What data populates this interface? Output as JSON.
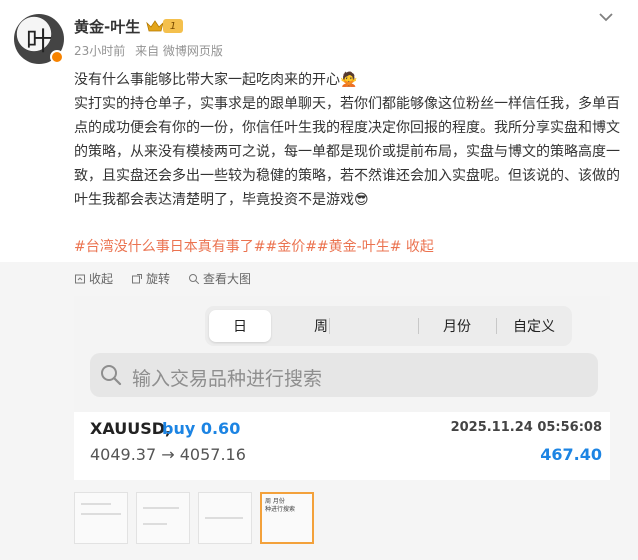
{
  "author": {
    "name": "黄金-叶生",
    "level": "1",
    "avatar_glyph": "叶",
    "time": "23小时前",
    "source": "来自 微博网页版"
  },
  "post": {
    "lines": [
      "没有什么事能够比带大家一起吃肉来的开心",
      "实打实的持仓单子，实事求是的跟单聊天，若你们都能够像这位粉丝一样信任我，多单百点的成功便会有你的一份，你信任叶生我的程度决定你回报的程度。我所分享实盘和博文的策略，从来没有模棱两可之说，每一单都是现价或提前布局，实盘与博文的策略高度一致，且实盘还会多出一些较为稳健的策略，若不然谁还会加入实盘呢。但该说的、该做的叶生我都会表达清楚明了，毕竟投资不是游戏"
    ],
    "emoji_1": "🙅",
    "emoji_2": "😎",
    "hashtags": "#台湾没什么事日本真有事了##金价##黄金-叶生# 收起"
  },
  "tools": {
    "collapse": "收起",
    "rotate": "旋转",
    "view_large": "查看大图"
  },
  "screenshot": {
    "tabs": [
      "日",
      "周",
      "月份",
      "自定义"
    ],
    "selected_tab": "日",
    "search_placeholder": "输入交易品种进行搜索",
    "symbol": "XAUUSD,",
    "side": "buy 0.60",
    "datetime": "2025.11.24 05:56:08",
    "prices": "4049.37 → 4057.16",
    "profit": "467.40"
  },
  "thumb_mini": {
    "tabs": "周    月份",
    "search": "种进行搜索"
  },
  "colors": {
    "link": "#eb7350",
    "accent_blue": "#1c84e3",
    "badge": "#f78300"
  }
}
